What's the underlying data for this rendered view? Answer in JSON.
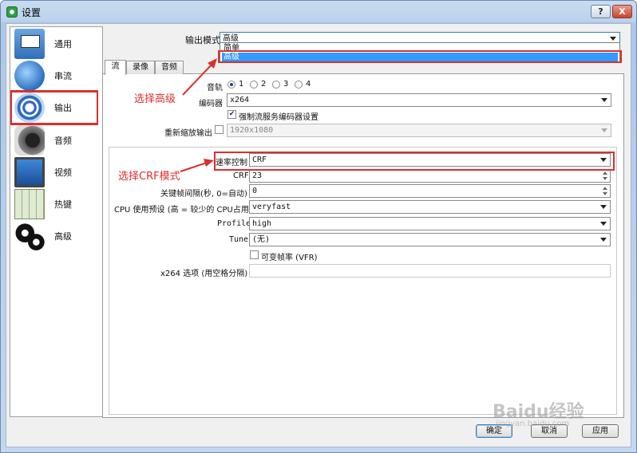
{
  "window": {
    "title": "设置",
    "help_label": "?",
    "close_label": "X"
  },
  "sidebar": {
    "items": [
      {
        "label": "通用"
      },
      {
        "label": "串流"
      },
      {
        "label": "输出"
      },
      {
        "label": "音频"
      },
      {
        "label": "视频"
      },
      {
        "label": "热键"
      },
      {
        "label": "高级"
      }
    ]
  },
  "output_mode": {
    "label": "输出模式",
    "value": "高级",
    "options": [
      "简单",
      "高级"
    ]
  },
  "tabs": [
    {
      "label": "流"
    },
    {
      "label": "录像"
    },
    {
      "label": "音频"
    }
  ],
  "stream": {
    "audio_track_label": "音轨",
    "audio_tracks": [
      "1",
      "2",
      "3",
      "4"
    ],
    "encoder_label": "编码器",
    "encoder_value": "x264",
    "enforce_label": "强制流服务编码器设置",
    "rescale_label": "重新缩放输出",
    "rescale_value": "1920x1080",
    "rate_control_label": "速率控制",
    "rate_control_value": "CRF",
    "crf_label": "CRF",
    "crf_value": "23",
    "keyframe_label": "关键帧间隔(秒, 0=自动)",
    "keyframe_value": "0",
    "cpu_preset_label": "CPU 使用预设 (高 = 较少的 CPU占用)",
    "cpu_preset_value": "veryfast",
    "profile_label": "Profile",
    "profile_value": "high",
    "tune_label": "Tune",
    "tune_value": "(无)",
    "vfr_label": "可变帧率 (VFR)",
    "x264_opts_label": "x264 选项 (用空格分隔)",
    "x264_opts_value": ""
  },
  "annotations": {
    "select_advanced": "选择高级",
    "select_crf": "选择CRF模式",
    "color": "#d9302c"
  },
  "buttons": {
    "ok": "确定",
    "cancel": "取消",
    "apply": "应用"
  },
  "watermark": {
    "brand": "Baidu经验",
    "url": "jingyan.baidu.com"
  }
}
